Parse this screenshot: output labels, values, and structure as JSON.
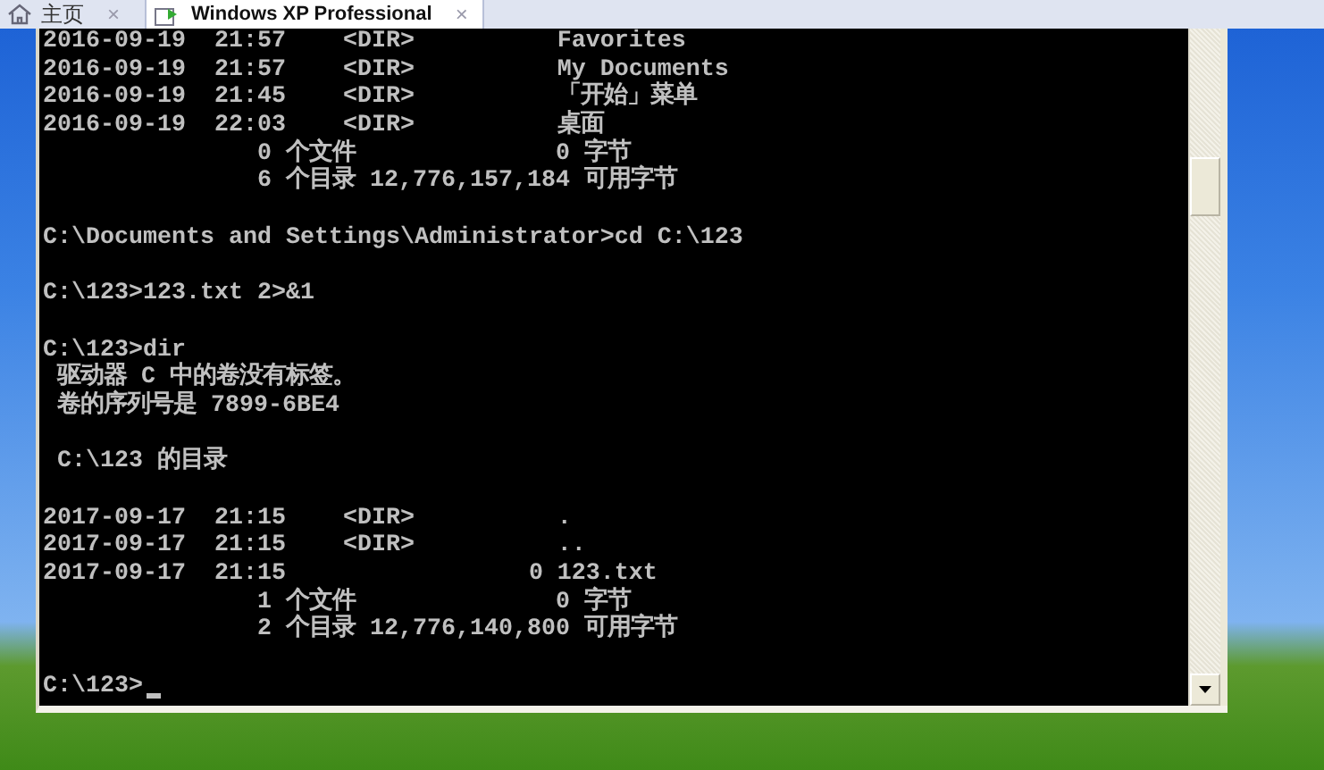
{
  "tabs": [
    {
      "label": "主页",
      "selected": false,
      "close": "×"
    },
    {
      "label": "Windows XP Professional",
      "selected": true,
      "close": "×"
    }
  ],
  "console": {
    "blocks": [
      [
        "2016-09-19  21:57    <DIR>          Favorites",
        "2016-09-19  21:57    <DIR>          My Documents",
        "2016-09-19  21:45    <DIR>          「开始」菜单",
        "2016-09-19  22:03    <DIR>          桌面",
        "               0 个文件              0 字节",
        "               6 个目录 12,776,157,184 可用字节"
      ],
      [
        "C:\\Documents and Settings\\Administrator>cd C:\\123"
      ],
      [
        "C:\\123>123.txt 2>&1"
      ],
      [
        "C:\\123>dir",
        " 驱动器 C 中的卷没有标签。",
        " 卷的序列号是 7899-6BE4"
      ],
      [
        " C:\\123 的目录"
      ],
      [
        "2017-09-17  21:15    <DIR>          .",
        "2017-09-17  21:15    <DIR>          ..",
        "2017-09-17  21:15                 0 123.txt",
        "               1 个文件              0 字节",
        "               2 个目录 12,776,140,800 可用字节"
      ],
      [
        "C:\\123>"
      ]
    ],
    "cursor": true
  }
}
